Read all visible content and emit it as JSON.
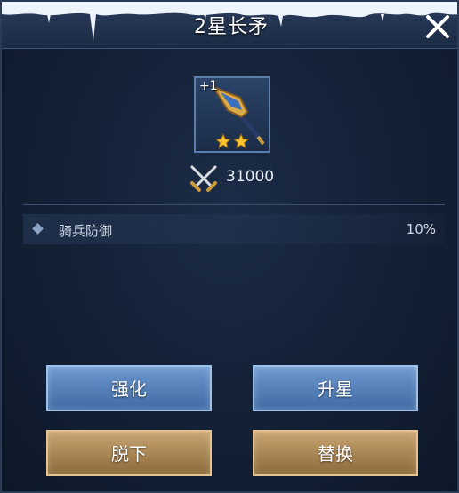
{
  "dialog": {
    "title": "2星长矛"
  },
  "item": {
    "icon": "spear-icon",
    "level_badge": "+1",
    "stars": 2
  },
  "power": {
    "icon": "crossed-swords-icon",
    "value": "31000"
  },
  "attributes": [
    {
      "name": "骑兵防御",
      "value": "10%"
    }
  ],
  "buttons": {
    "enhance": "强化",
    "upgrade_star": "升星",
    "unequip": "脱下",
    "replace": "替换"
  },
  "colors": {
    "title_text": "#ffffff",
    "button_blue": "#4f7bb4",
    "button_gold": "#a88354",
    "star": "#f7c531"
  }
}
